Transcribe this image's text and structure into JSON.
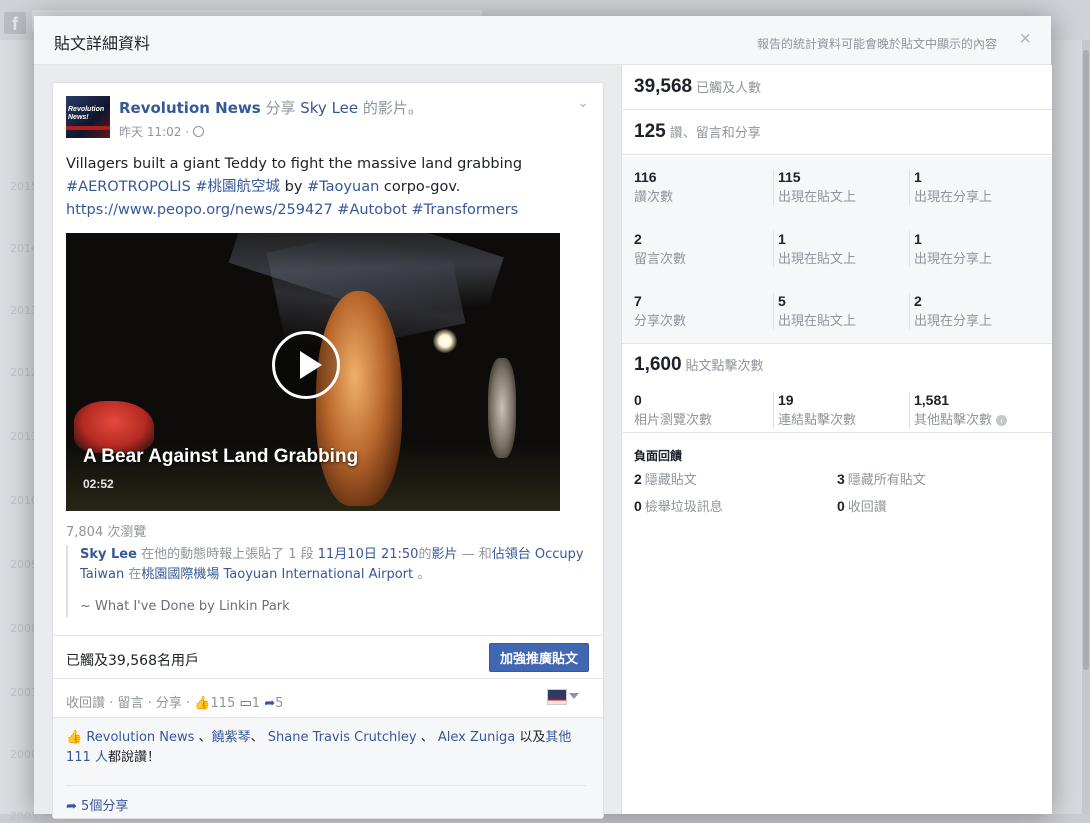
{
  "dialog": {
    "title": "貼文詳細資料",
    "note": "報告的統計資料可能會晚於貼文中顯示的內容",
    "close": "×"
  },
  "post": {
    "page_name": "Revolution News",
    "share_verb": "分享",
    "shared_user": "Sky Lee",
    "shared_suffix": "的影片。",
    "timestamp": "昨天 11:02 ·",
    "text_line1": "Villagers built a giant Teddy to fight the massive land grabbing",
    "tag1": "#AEROTROPOLIS",
    "tag2": "#桃園航空城",
    "text_by": "by",
    "tag3": "#Taoyuan",
    "text_corp": "corpo-gov.",
    "url": "https://www.peopo.org/news/259427",
    "tag4": "#Autobot",
    "tag5": "#Transformers",
    "video": {
      "title": "A Bear Against Land Grabbing",
      "duration": "02:52"
    },
    "views": "7,804 次瀏覽",
    "shared_from": {
      "user": "Sky Lee",
      "text1": "在他的動態時報上張貼了 1 段",
      "date": "11月10日 21:50",
      "text2": "的",
      "video_word": "影片",
      "text3": "— 和",
      "with": "佔領台 Occupy Taiwan",
      "at_word": "在",
      "place": "桃園國際機場 Taoyuan International Airport",
      "end": "。",
      "song": "~ What I've Done by Linkin Park"
    },
    "reached": "已觸及39,568名用戶",
    "boost_label": "加強推廣貼文",
    "actions": {
      "unlike": "收回讚",
      "comment": "留言",
      "share": "分享",
      "sep": "·",
      "like_count": "115",
      "comment_count": "1",
      "share_count": "5"
    },
    "likes": {
      "name1": "Revolution News",
      "sep1": "、",
      "name2": "饒紫琴",
      "sep2": "、",
      "name3": "Shane Travis Crutchley",
      "sep3": "、",
      "name4": "Alex Zuniga",
      "others_prefix": "以及",
      "others": "其他 111 人",
      "suffix": "都說讚！"
    },
    "shares_text": "5個分享"
  },
  "stats": {
    "reach": {
      "value": "39,568",
      "label": "已觸及人數"
    },
    "engagement": {
      "value": "125",
      "label": "讚、留言和分享"
    },
    "rows": [
      {
        "v1": "116",
        "l1": "讚次數",
        "v2": "115",
        "l2": "出現在貼文上",
        "v3": "1",
        "l3": "出現在分享上"
      },
      {
        "v1": "2",
        "l1": "留言次數",
        "v2": "1",
        "l2": "出現在貼文上",
        "v3": "1",
        "l3": "出現在分享上"
      },
      {
        "v1": "7",
        "l1": "分享次數",
        "v2": "5",
        "l2": "出現在貼文上",
        "v3": "2",
        "l3": "出現在分享上"
      }
    ],
    "clicks": {
      "value": "1,600",
      "label": "貼文點擊次數",
      "photo_value": "0",
      "photo_label": "相片瀏覽次數",
      "link_value": "19",
      "link_label": "連結點擊次數",
      "other_value": "1,581",
      "other_label": "其他點擊次數"
    },
    "negative": {
      "title": "負面回饋",
      "hide_post_value": "2",
      "hide_post_label": "隱藏貼文",
      "hide_all_value": "3",
      "hide_all_label": "隱藏所有貼文",
      "spam_value": "0",
      "spam_label": "檢舉垃圾訊息",
      "unlike_value": "0",
      "unlike_label": "收回讚"
    }
  },
  "background": {
    "logo": "f",
    "years": [
      "2015",
      "2014",
      "2013",
      "2012",
      "2011",
      "2010",
      "2009",
      "2008",
      "2007",
      "2006",
      "2005"
    ]
  }
}
